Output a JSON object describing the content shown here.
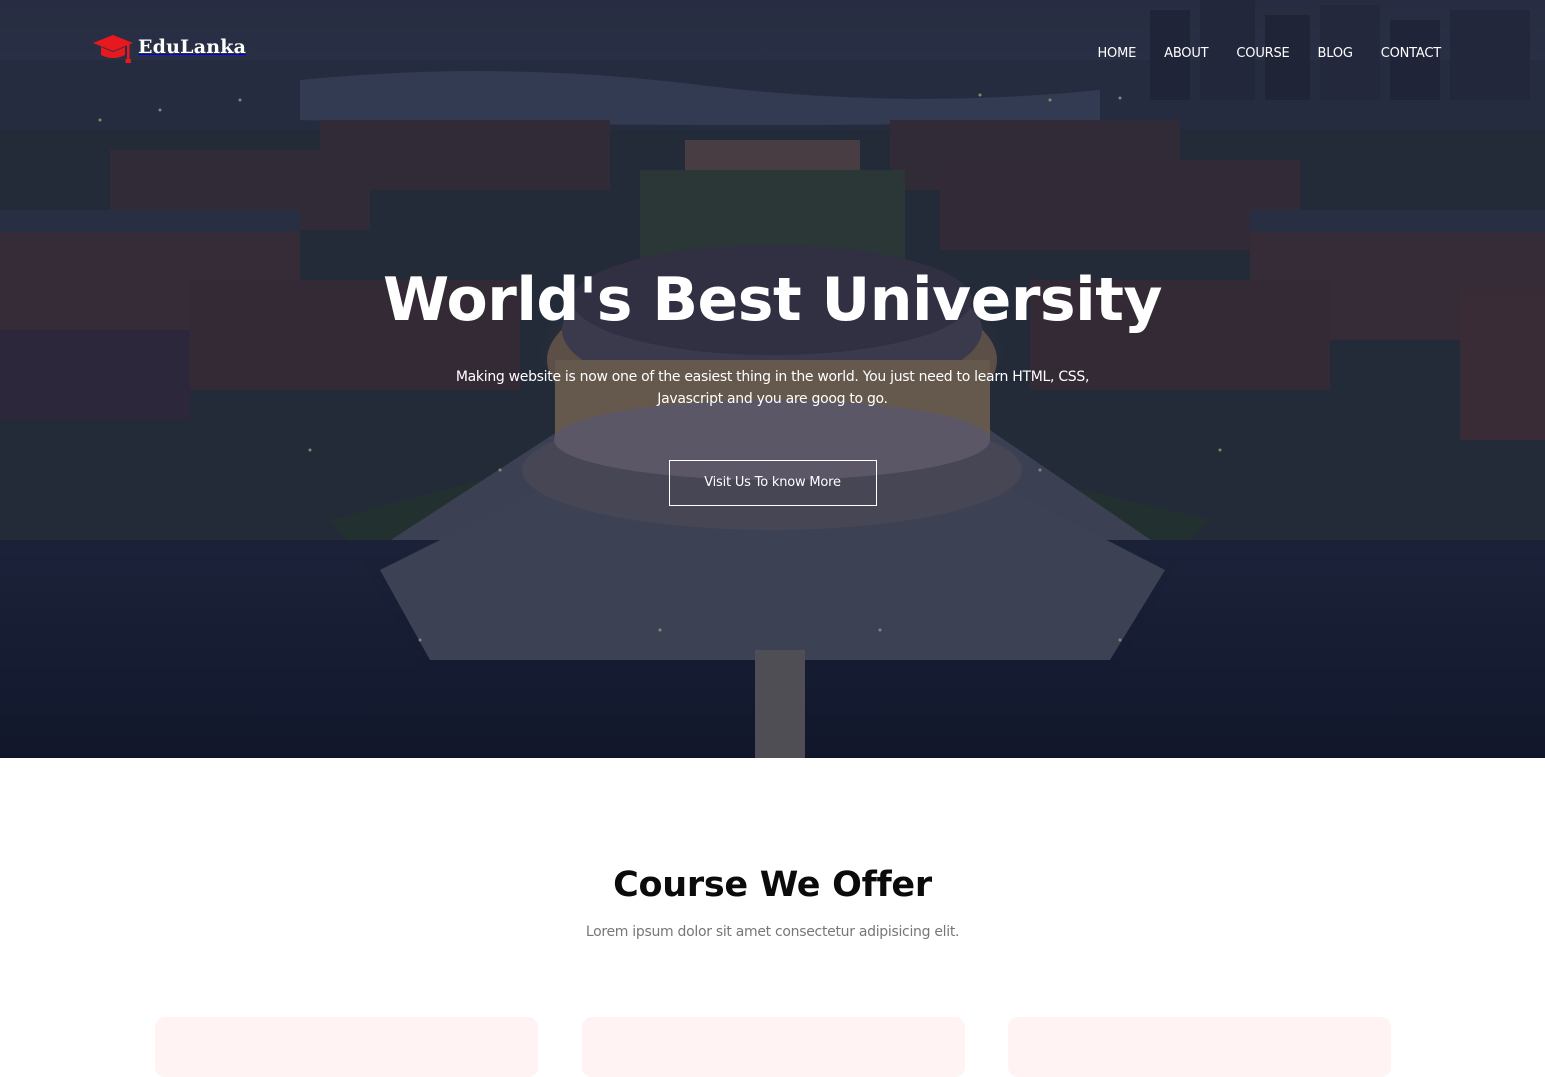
{
  "brand": {
    "name": "EduLanka",
    "logo_icon": "graduation-cap-icon",
    "accent_color": "#e8191e"
  },
  "nav": {
    "items": [
      {
        "label": "HOME"
      },
      {
        "label": "ABOUT"
      },
      {
        "label": "COURSE"
      },
      {
        "label": "BLOG"
      },
      {
        "label": "CONTACT"
      }
    ]
  },
  "hero": {
    "title": "World's Best University",
    "subtitle": "Making website is now one of the easiest thing in the world. You just need to learn HTML, CSS, Javascript and you are goog to go.",
    "button_label": "Visit Us To know More",
    "overlay_color": "#04091e"
  },
  "courses": {
    "title": "Course We Offer",
    "subtitle": "Lorem ipsum dolor sit amet consectetur adipisicing elit.",
    "card_color": "#fff3f3"
  }
}
